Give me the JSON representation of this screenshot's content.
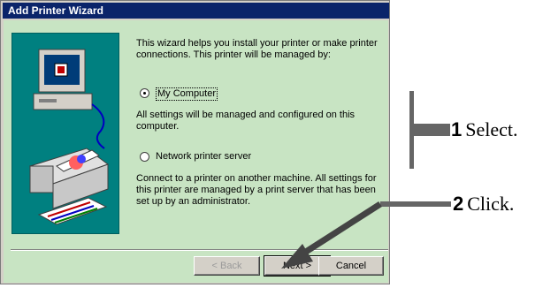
{
  "window": {
    "title": "Add Printer Wizard"
  },
  "intro": "This wizard helps you install your printer or make printer connections.  This printer will be managed by:",
  "options": [
    {
      "label": "My Computer",
      "selected": true,
      "description": "All settings will be managed and configured on this computer."
    },
    {
      "label": "Network printer server",
      "selected": false,
      "description": "Connect to a printer on another machine.  All settings for this printer are managed by a print server that has been set up by an administrator."
    }
  ],
  "buttons": {
    "back": "< Back",
    "next": "Next >",
    "cancel": "Cancel"
  },
  "annotations": {
    "step1_number": "1",
    "step1_text": "Select.",
    "step2_number": "2",
    "step2_text": "Click."
  },
  "colors": {
    "titlebar": "#0a246a",
    "client": "#c8e4c3",
    "illustration_bg": "#008080"
  }
}
